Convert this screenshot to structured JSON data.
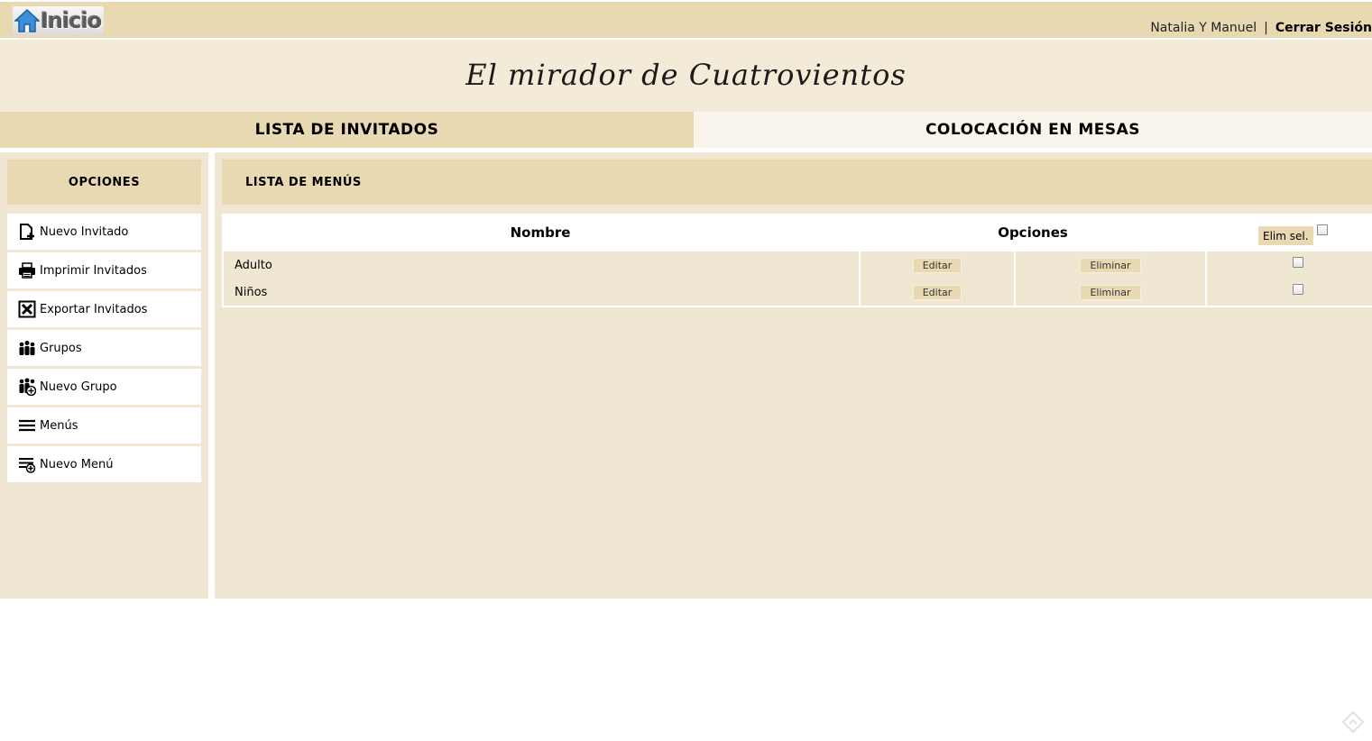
{
  "header": {
    "home_label": "Inicio",
    "user_name": "Natalia Y Manuel",
    "separator": "|",
    "logout_label": "Cerrar Sesión"
  },
  "banner": {
    "title": "El mirador de Cuatrovientos"
  },
  "tabs": [
    {
      "label": "LISTA DE INVITADOS",
      "active": true
    },
    {
      "label": "COLOCACIÓN EN MESAS",
      "active": false
    }
  ],
  "sidebar": {
    "title": "OPCIONES",
    "items": [
      {
        "label": "Nuevo Invitado",
        "icon": "new-document-icon"
      },
      {
        "label": "Imprimir Invitados",
        "icon": "printer-icon"
      },
      {
        "label": "Exportar Invitados",
        "icon": "excel-export-icon"
      },
      {
        "label": "Grupos",
        "icon": "group-icon"
      },
      {
        "label": "Nuevo Grupo",
        "icon": "add-group-icon"
      },
      {
        "label": "Menús",
        "icon": "menu-list-icon"
      },
      {
        "label": "Nuevo Menú",
        "icon": "add-menu-icon"
      }
    ]
  },
  "main": {
    "title": "LISTA DE MENÚS",
    "table": {
      "col_name": "Nombre",
      "col_options": "Opciones",
      "delete_selected_label": "Elim sel.",
      "edit_label": "Editar",
      "delete_label": "Eliminar",
      "rows": [
        {
          "name": "Adulto"
        },
        {
          "name": "Niños"
        }
      ]
    }
  },
  "colors": {
    "bar": "#e8d9b3",
    "panel": "#f0e7d2",
    "banner": "#f3ebd8",
    "home_icon_blue": "#3a8fd8"
  }
}
